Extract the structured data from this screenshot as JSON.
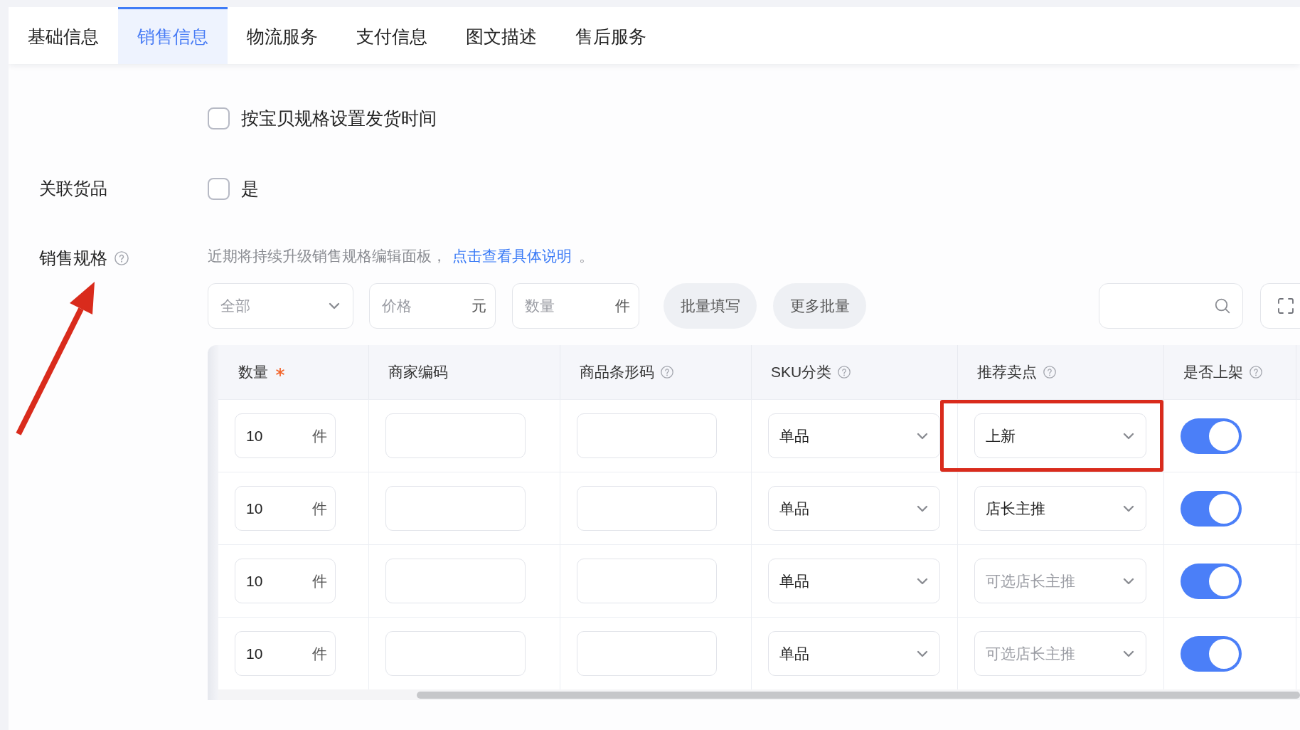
{
  "tabs": [
    {
      "label": "基础信息",
      "selected": false
    },
    {
      "label": "销售信息",
      "selected": true
    },
    {
      "label": "物流服务",
      "selected": false
    },
    {
      "label": "支付信息",
      "selected": false
    },
    {
      "label": "图文描述",
      "selected": false
    },
    {
      "label": "售后服务",
      "selected": false
    }
  ],
  "shipping_time_option": {
    "label": "按宝贝规格设置发货时间",
    "checked": false
  },
  "linked_goods": {
    "label": "关联货品",
    "option": {
      "label": "是",
      "checked": false
    }
  },
  "sales_spec": {
    "label": "销售规格",
    "help": true,
    "arrow": true,
    "notice": "近期将持续升级销售规格编辑面板，",
    "link": "点击查看具体说明",
    "notice_end": "。",
    "toolbar": {
      "filter": {
        "placeholder": "全部"
      },
      "price": {
        "placeholder": "价格",
        "unit": "元"
      },
      "quantity": {
        "placeholder": "数量",
        "unit": "件"
      },
      "buttons": [
        "批量填写",
        "更多批量"
      ]
    },
    "table": {
      "columns": [
        {
          "label": "数量",
          "required": true,
          "help": false
        },
        {
          "label": "商家编码",
          "required": false,
          "help": false
        },
        {
          "label": "商品条形码",
          "required": false,
          "help": true
        },
        {
          "label": "SKU分类",
          "required": false,
          "help": true
        },
        {
          "label": "推荐卖点",
          "required": false,
          "help": true
        },
        {
          "label": "是否上架",
          "required": false,
          "help": true
        }
      ],
      "rows": [
        {
          "cells": [
            {
              "kind": "quantity",
              "value": "10",
              "unit": "件"
            },
            {
              "kind": "input"
            },
            {
              "kind": "input"
            },
            {
              "kind": "select",
              "value": "单品",
              "highlighted": false
            },
            {
              "kind": "select",
              "value": "上新",
              "highlighted": true
            },
            {
              "kind": "switch",
              "on": true
            }
          ]
        },
        {
          "cells": [
            {
              "kind": "quantity",
              "value": "10",
              "unit": "件"
            },
            {
              "kind": "input"
            },
            {
              "kind": "input"
            },
            {
              "kind": "select",
              "value": "单品",
              "highlighted": false
            },
            {
              "kind": "select",
              "value": "店长主推",
              "highlighted": false
            },
            {
              "kind": "switch",
              "on": true
            }
          ]
        },
        {
          "cells": [
            {
              "kind": "quantity",
              "value": "10",
              "unit": "件"
            },
            {
              "kind": "input"
            },
            {
              "kind": "input"
            },
            {
              "kind": "select",
              "value": "单品",
              "highlighted": false
            },
            {
              "kind": "select",
              "placeholder": "可选店长主推",
              "highlighted": false
            },
            {
              "kind": "switch",
              "on": true
            }
          ]
        },
        {
          "cells": [
            {
              "kind": "quantity",
              "value": "10",
              "unit": "件"
            },
            {
              "kind": "input"
            },
            {
              "kind": "input"
            },
            {
              "kind": "select",
              "value": "单品",
              "highlighted": false
            },
            {
              "kind": "select",
              "placeholder": "可选店长主推",
              "highlighted": false
            },
            {
              "kind": "switch",
              "on": true
            }
          ]
        }
      ]
    }
  }
}
